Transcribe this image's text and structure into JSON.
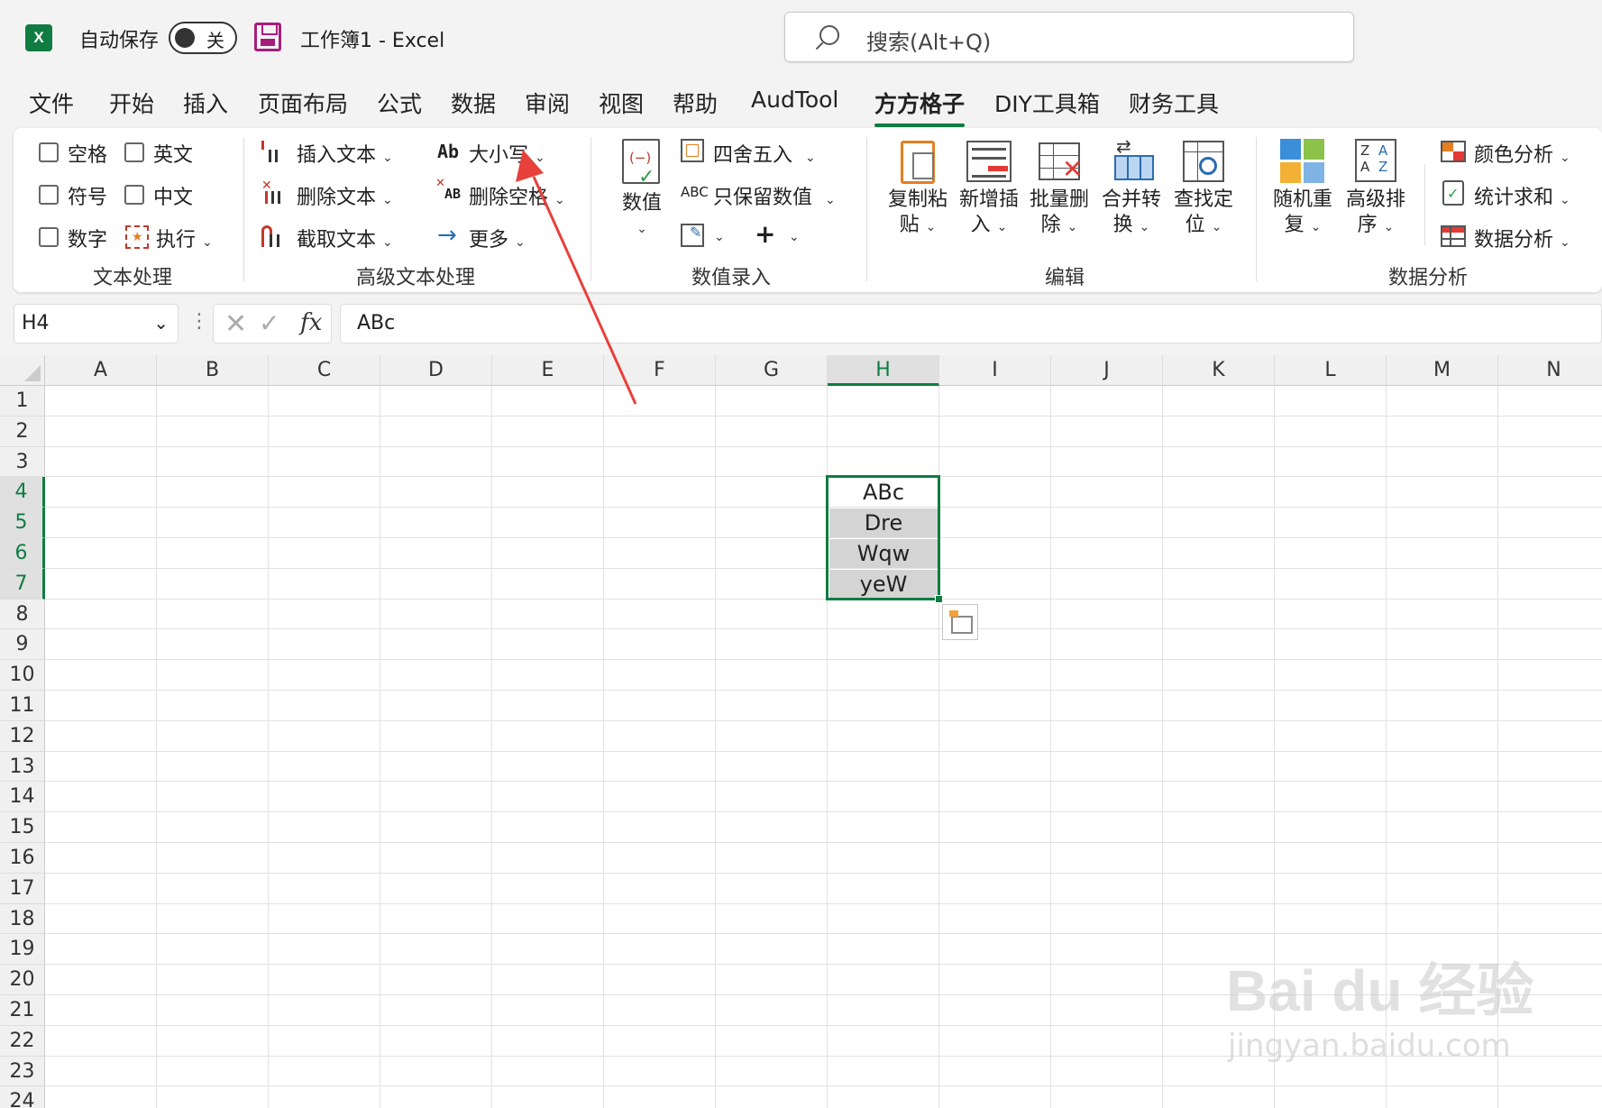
{
  "titlebar": {
    "app_icon": "X",
    "autosave_label": "自动保存",
    "autosave_state": "关",
    "title": "工作簿1  -  Excel",
    "search_placeholder": "搜索(Alt+Q)"
  },
  "tabs": [
    "文件",
    "开始",
    "插入",
    "页面布局",
    "公式",
    "数据",
    "审阅",
    "视图",
    "帮助",
    "AudTool",
    "方方格子",
    "DIY工具箱",
    "财务工具"
  ],
  "active_tab": "方方格子",
  "ribbon": {
    "text_processing": {
      "checkboxes": [
        "空格",
        "英文",
        "符号",
        "中文",
        "数字"
      ],
      "execute": "执行",
      "label": "文本处理"
    },
    "advanced_text": {
      "insert_text": "插入文本",
      "delete_text": "删除文本",
      "extract_text": "截取文本",
      "case_icon": "Ab",
      "case": "大小写",
      "delete_space": "删除空格",
      "delete_space_icon": "AB",
      "more": "更多",
      "label": "高级文本处理"
    },
    "numeric_entry": {
      "value": "数值",
      "round": "四舍五入",
      "keep_values": "只保留数值",
      "keep_values_icon": "ABC",
      "label": "数值录入"
    },
    "edit": {
      "copy_paste": [
        "复制粘",
        "贴"
      ],
      "add_insert": [
        "新增插",
        "入"
      ],
      "batch_delete": [
        "批量删",
        "除"
      ],
      "merge_convert": [
        "合并转",
        "换"
      ],
      "find_locate": [
        "查找定",
        "位"
      ],
      "label": "编辑"
    },
    "data_analysis": {
      "random_repeat": [
        "随机重",
        "复"
      ],
      "advanced_sort": [
        "高级排",
        "序"
      ],
      "color_analysis": "颜色分析",
      "stat_sum": "统计求和",
      "data_analysis": "数据分析",
      "label": "数据分析"
    }
  },
  "formula_bar": {
    "name_box": "H4",
    "fx": "fx",
    "value": "ABc"
  },
  "grid": {
    "columns": [
      "A",
      "B",
      "C",
      "D",
      "E",
      "F",
      "G",
      "H",
      "I",
      "J",
      "K",
      "L",
      "M",
      "N"
    ],
    "rows": [
      "1",
      "2",
      "3",
      "4",
      "5",
      "6",
      "7",
      "8",
      "9",
      "10",
      "11",
      "12",
      "13",
      "14",
      "15",
      "16",
      "17",
      "18",
      "19",
      "20",
      "21",
      "22",
      "23",
      "24"
    ],
    "cells": {
      "H4": "ABc",
      "H5": "Dre",
      "H6": "Wqw",
      "H7": "yeW"
    },
    "selected_column": "H",
    "selected_rows": [
      "4",
      "5",
      "6",
      "7"
    ]
  },
  "annotation_color": "#e8403a",
  "watermark": {
    "main": "Bai du 经验",
    "sub": "jingyan.baidu.com"
  }
}
